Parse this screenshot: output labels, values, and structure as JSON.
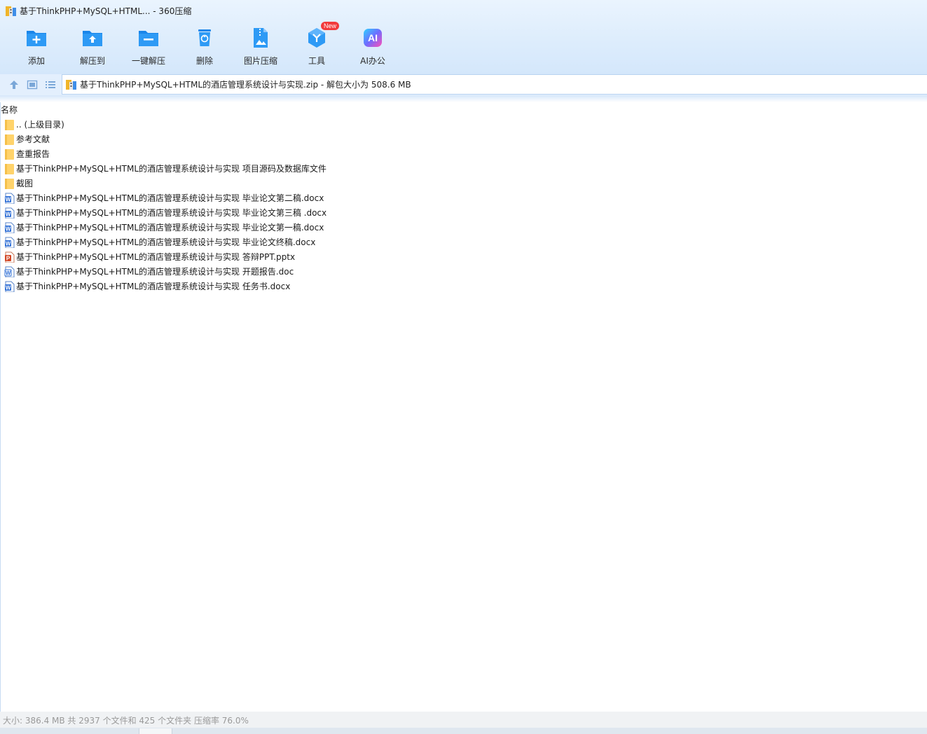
{
  "window": {
    "title": "基于ThinkPHP+MySQL+HTML... - 360压缩"
  },
  "toolbar": {
    "items": [
      {
        "label": "添加",
        "icon": "add-folder-icon"
      },
      {
        "label": "解压到",
        "icon": "extract-to-icon"
      },
      {
        "label": "一键解压",
        "icon": "one-click-extract-icon"
      },
      {
        "label": "删除",
        "icon": "trash-icon"
      },
      {
        "label": "图片压缩",
        "icon": "image-compress-icon"
      },
      {
        "label": "工具",
        "icon": "tools-icon",
        "badge": "New"
      },
      {
        "label": "AI办公",
        "icon": "ai-office-icon",
        "icon_text": "AI"
      }
    ]
  },
  "addressbar": {
    "path": "基于ThinkPHP+MySQL+HTML的酒店管理系统设计与实现.zip - 解包大小为 508.6 MB"
  },
  "filelist": {
    "column_name": "名称",
    "rows": [
      {
        "name": ".. (上级目录)",
        "type": "folder"
      },
      {
        "name": "参考文献",
        "type": "folder"
      },
      {
        "name": "查重报告",
        "type": "folder"
      },
      {
        "name": "基于ThinkPHP+MySQL+HTML的酒店管理系统设计与实现 项目源码及数据库文件",
        "type": "folder"
      },
      {
        "name": "截图",
        "type": "folder"
      },
      {
        "name": "基于ThinkPHP+MySQL+HTML的酒店管理系统设计与实现 毕业论文第二稿.docx",
        "type": "word"
      },
      {
        "name": "基于ThinkPHP+MySQL+HTML的酒店管理系统设计与实现 毕业论文第三稿 .docx",
        "type": "word"
      },
      {
        "name": "基于ThinkPHP+MySQL+HTML的酒店管理系统设计与实现 毕业论文第一稿.docx",
        "type": "word"
      },
      {
        "name": "基于ThinkPHP+MySQL+HTML的酒店管理系统设计与实现 毕业论文终稿.docx",
        "type": "word"
      },
      {
        "name": "基于ThinkPHP+MySQL+HTML的酒店管理系统设计与实现 答辩PPT.pptx",
        "type": "ppt"
      },
      {
        "name": "基于ThinkPHP+MySQL+HTML的酒店管理系统设计与实现 开题报告.doc",
        "type": "doc"
      },
      {
        "name": "基于ThinkPHP+MySQL+HTML的酒店管理系统设计与实现 任务书.docx",
        "type": "word"
      }
    ]
  },
  "statusbar": {
    "text": "大小: 386.4 MB 共 2937 个文件和 425 个文件夹 压缩率 76.0%"
  },
  "colors": {
    "accent": "#1e8ff0",
    "folder": "#ffd36b",
    "word": "#2f6fd6",
    "ppt": "#d24726",
    "badge": "#f23b3b"
  }
}
